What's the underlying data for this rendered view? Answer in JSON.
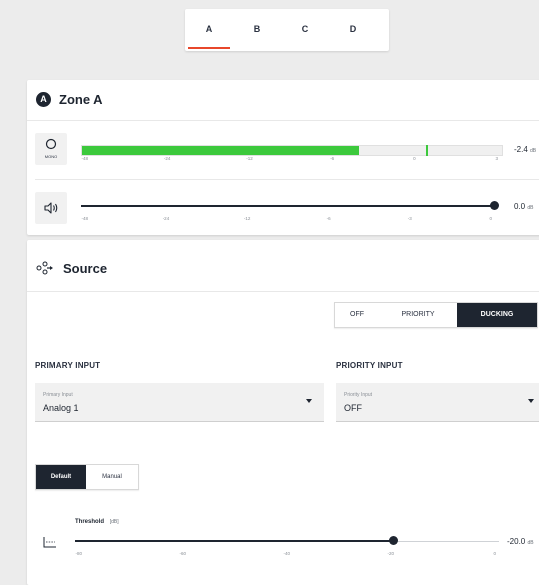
{
  "tabs": [
    {
      "label": "A",
      "active": true
    },
    {
      "label": "B"
    },
    {
      "label": "C"
    },
    {
      "label": "D"
    }
  ],
  "zone": {
    "badge": "A",
    "title": "Zone A",
    "mono_label": "MONO",
    "meter": {
      "scale": [
        "-48",
        "-24",
        "-12",
        "-6",
        "0",
        "3"
      ],
      "level_fraction": 0.66,
      "peak_fraction": 0.82,
      "readout_value": "-2.4",
      "readout_unit": "dB",
      "color": "#3cc93c"
    },
    "volume": {
      "scale": [
        "-48",
        "-24",
        "-12",
        "-6",
        "-3",
        "0"
      ],
      "value_fraction": 1.0,
      "readout_value": "0.0",
      "readout_unit": "dB"
    }
  },
  "source": {
    "title": "Source",
    "mode_options": [
      "OFF",
      "PRIORITY",
      "DUCKING"
    ],
    "mode_selected": "DUCKING",
    "primary": {
      "section_label": "PRIMARY INPUT",
      "field_label": "Primary Input",
      "value": "Analog 1"
    },
    "priority": {
      "section_label": "PRIORITY INPUT",
      "field_label": "Priority Input",
      "value": "OFF"
    },
    "preset_options": [
      "Default",
      "Manual"
    ],
    "preset_selected": "Default",
    "threshold": {
      "label": "Threshold",
      "unit_label": "[dB]",
      "scale": [
        "-80",
        "-60",
        "-40",
        "-20",
        "0"
      ],
      "value_fraction": 0.75,
      "readout_value": "-20.0",
      "readout_unit": "dB"
    }
  }
}
